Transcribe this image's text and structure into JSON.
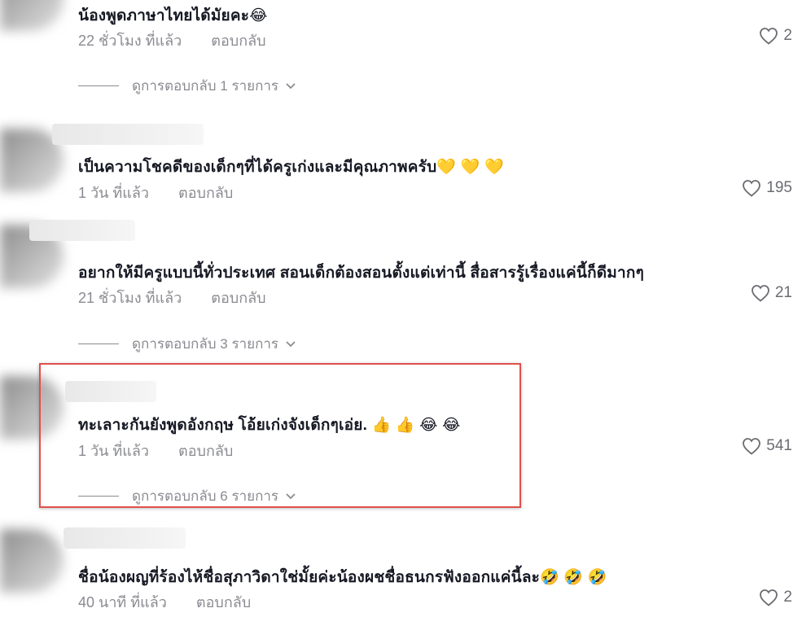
{
  "comments": [
    {
      "text": "น้องพูดภาษาไทยได้มัยคะ😂",
      "time": "22 ชั่วโมง ที่แล้ว",
      "reply": "ตอบกลับ",
      "likes": "2",
      "view_replies": "ดูการตอบกลับ 1 รายการ"
    },
    {
      "text": "เป็นความโชคดีของเด็กๆที่ได้ครูเก่งและมีคุณภาพครับ💛 💛 💛",
      "time": "1 วัน ที่แล้ว",
      "reply": "ตอบกลับ",
      "likes": "195"
    },
    {
      "text": "อยากให้มีครูแบบนี้ทั่วประเทศ สอนเด็กต้องสอนตั้งแต่เท่านี้ สื่อสารรู้เรื่องแค่นี้ก็ดีมากๆ",
      "time": "21 ชั่วโมง ที่แล้ว",
      "reply": "ตอบกลับ",
      "likes": "21",
      "view_replies": "ดูการตอบกลับ 3 รายการ"
    },
    {
      "text": "ทะเลาะกันยังพูดอังกฤษ โอ้ยเก่งจังเด็กๆเอ่ย. 👍 👍 😂 😂",
      "time": "1 วัน ที่แล้ว",
      "reply": "ตอบกลับ",
      "likes": "541",
      "view_replies": "ดูการตอบกลับ 6 รายการ"
    },
    {
      "text": "ชื่อน้องผญที่ร้องไห้ชื่อสุภาวิดาใช่มั้ยค่ะน้องผชชื่อธนกรฟังออกแค่นี้ละ🤣 🤣 🤣",
      "time": "40 นาที ที่แล้ว",
      "reply": "ตอบกลับ",
      "likes": "2"
    }
  ],
  "colors": {
    "highlight_border": "#e0504c",
    "secondary_text": "#8a8b91",
    "primary_text": "#161823"
  },
  "icons": {
    "like": "heart-outline-icon",
    "expand": "chevron-down-icon"
  }
}
